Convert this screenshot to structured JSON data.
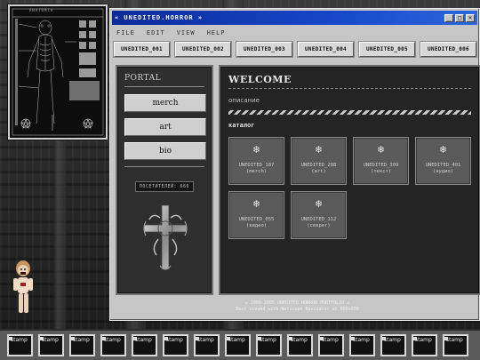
{
  "window": {
    "title": "« UNEDITED.HORROR »",
    "controls": [
      "_",
      "□",
      "×"
    ]
  },
  "menu": [
    "FILE",
    "EDIT",
    "VIEW",
    "HELP"
  ],
  "tabs": [
    "UNEDITED_001",
    "UNEDITED_002",
    "UNEDITED_003",
    "UNEDITED_004",
    "UNEDITED_005",
    "UNEDITED_006"
  ],
  "sidebar": {
    "heading": "PORTAL",
    "buttons": [
      "merch",
      "art",
      "bio"
    ],
    "visitors": "ПОСЕТИТЕЛЕЙ: 666"
  },
  "main": {
    "heading": "WELCOME",
    "description": "описание",
    "catalog_heading": "каталог",
    "catalog_icon": "spiderweb-icon",
    "items": [
      {
        "name": "UNEDITED_187",
        "sub": "(merch)"
      },
      {
        "name": "UNEDITED_288",
        "sub": "(art)"
      },
      {
        "name": "UNEDITED_309",
        "sub": "(текст)"
      },
      {
        "name": "UNEDITED_401",
        "sub": "(аудио)"
      },
      {
        "name": "UNEDITED_055",
        "sub": "(видео)"
      },
      {
        "name": "UNEDITED_112",
        "sub": "(секрет)"
      }
    ]
  },
  "footer": {
    "line1": "☠ 2000-2005 UNEDITED HORROR PORTFOLIO ☠",
    "line2": "Best viewed with Netscape Navigator at 800x600"
  },
  "stamps": {
    "label": "stamp",
    "count": 15
  },
  "colors": {
    "titlebar": "#0c2b9a",
    "window_bg": "#c6c6c6",
    "panel_bg": "#242424",
    "card_bg": "#5a5a5a"
  }
}
